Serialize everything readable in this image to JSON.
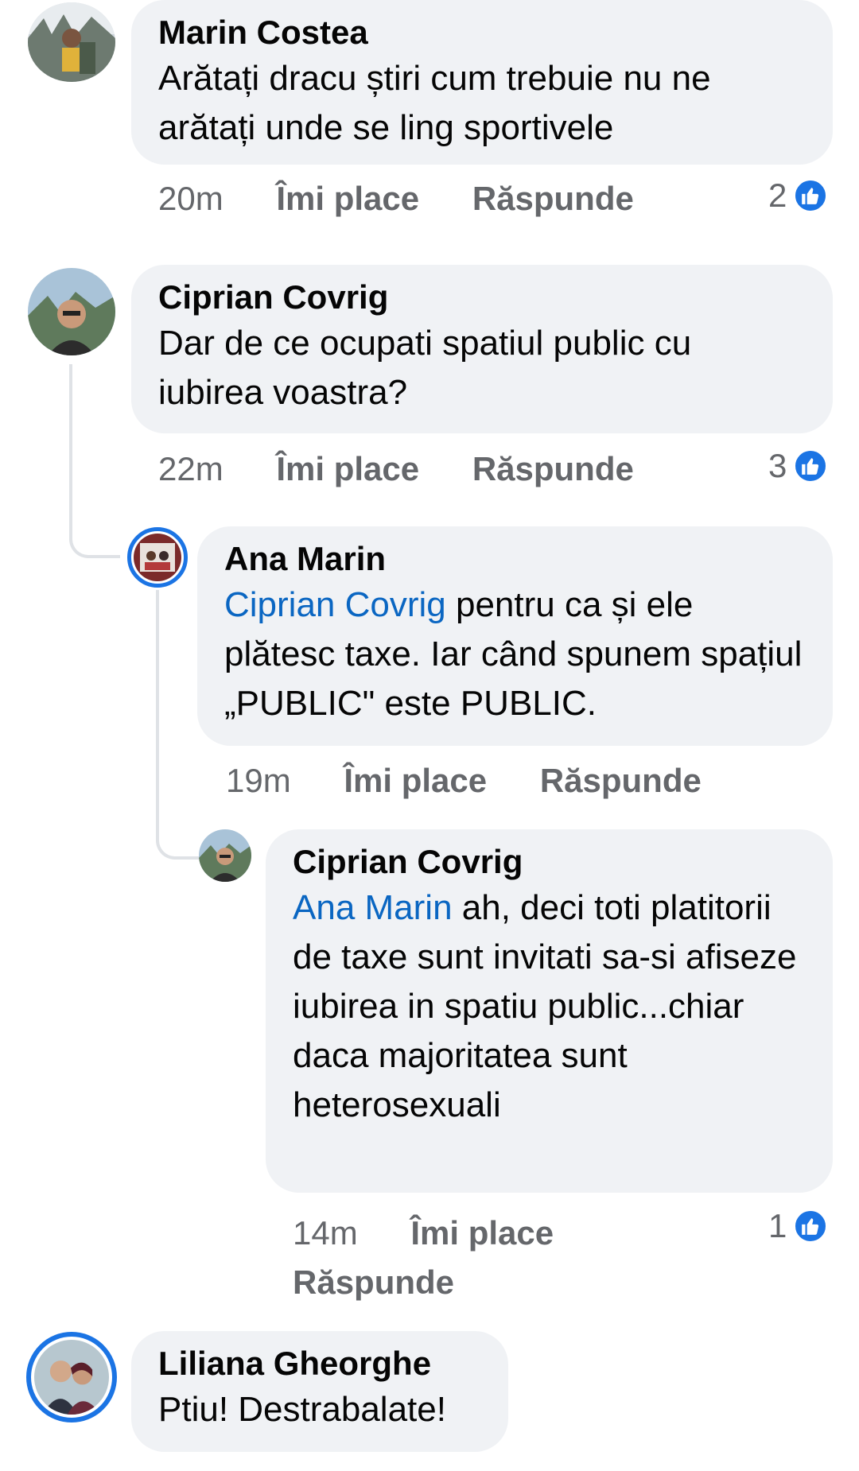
{
  "comments": [
    {
      "author": "Marin Costea",
      "text": "Arătați dracu știri cum trebuie nu ne arătați unde se ling sportivele",
      "time": "20m",
      "like_label": "Îmi place",
      "reply_label": "Răspunde",
      "reaction_count": "2"
    },
    {
      "author": "Ciprian Covrig",
      "text": "Dar de ce ocupati spatiul public cu iubirea voastra?",
      "time": "22m",
      "like_label": "Îmi place",
      "reply_label": "Răspunde",
      "reaction_count": "3"
    },
    {
      "author": "Ana Marin",
      "mention": "Ciprian Covrig",
      "text": " pentru ca și ele plătesc taxe. Iar când spunem spațiul „PUBLIC\" este PUBLIC.",
      "time": "19m",
      "like_label": "Îmi place",
      "reply_label": "Răspunde"
    },
    {
      "author": "Ciprian Covrig",
      "mention": "Ana Marin",
      "text": " ah, deci toti platitorii de taxe sunt invitati sa-si afiseze iubirea in spatiu public...chiar daca majoritatea sunt heterosexuali",
      "time": "14m",
      "like_label": "Îmi place",
      "reply_label": "Răspunde",
      "reaction_count": "1"
    },
    {
      "author": "Liliana Gheorghe",
      "text": "Ptiu! Destrabalate!"
    }
  ],
  "icons": {
    "reaction": "thumbs-up-icon",
    "accent": "#1b74e4"
  }
}
